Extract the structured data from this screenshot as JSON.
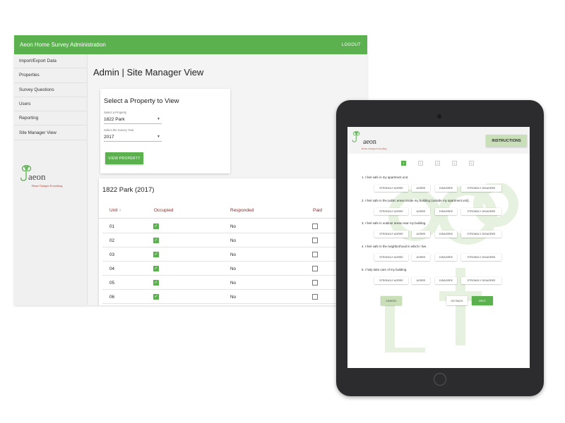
{
  "admin": {
    "app_title": "Aeon Home Survey Administration",
    "logout_label": "LOGOUT",
    "nav": [
      "Import/Export Data",
      "Properties",
      "Survey Questions",
      "Users",
      "Reporting",
      "Site Manager View"
    ],
    "logo_word": "aeon",
    "logo_tagline": "Home Changes Everything",
    "page_title": "Admin | Site Manager View",
    "select_card": {
      "title": "Select a Property to View",
      "property_label": "Select a Property",
      "property_value": "1822 Park",
      "year_label": "Select the Survey Year",
      "year_value": "2017",
      "button_label": "VIEW PROPERTY"
    },
    "table": {
      "title": "1822 Park (2017)",
      "headers": [
        "Unit",
        "Occupied",
        "Responded",
        "Paid"
      ],
      "sort_icon": "arrow-up-icon",
      "rows": [
        {
          "unit": "01",
          "occupied": true,
          "responded": "No",
          "paid": false
        },
        {
          "unit": "02",
          "occupied": true,
          "responded": "No",
          "paid": false
        },
        {
          "unit": "03",
          "occupied": true,
          "responded": "No",
          "paid": false
        },
        {
          "unit": "04",
          "occupied": true,
          "responded": "No",
          "paid": false
        },
        {
          "unit": "05",
          "occupied": true,
          "responded": "No",
          "paid": false
        },
        {
          "unit": "06",
          "occupied": true,
          "responded": "No",
          "paid": false
        }
      ]
    }
  },
  "tablet": {
    "logo_word": "aeon",
    "logo_tagline": "Home Changes Everything",
    "instructions_label": "INSTRUCTIONS",
    "steps": [
      "1",
      "2",
      "3",
      "4",
      "5"
    ],
    "active_step": 1,
    "questions": [
      "1. I feel safe in my apartment unit.",
      "2. I feel safe in the public areas inside my building (outside my apartment unit).",
      "3. I feel safe in outdoor areas near my building.",
      "4. I feel safe in the neighborhood in which I live.",
      "5. I help take care of my building."
    ],
    "options": [
      "STRONGLY AGREE",
      "AGREE",
      "DISAGREE",
      "STRONGLY DISAGREE"
    ],
    "cancel_label": "CANCEL",
    "back_label": "GO BACK",
    "next_label": "NEXT"
  },
  "colors": {
    "brand_green": "#5ab14e",
    "header_red": "#8a2a2a",
    "tablet_body": "#2c2c2e",
    "light_green": "#c9dfb8"
  }
}
